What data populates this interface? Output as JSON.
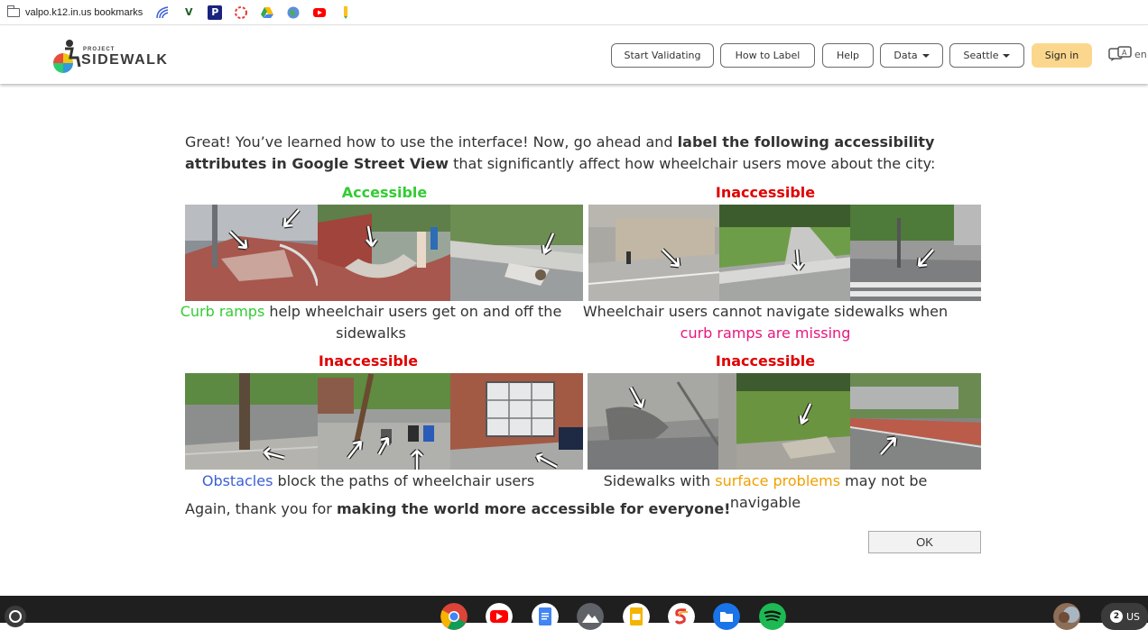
{
  "bookmarks": {
    "folder_label": "valpo.k12.in.us bookmarks",
    "icons": [
      "signal-icon",
      "vimeo-v-icon",
      "p-icon",
      "target-icon",
      "drive-icon",
      "globe-icon",
      "youtube-icon",
      "pencil-icon"
    ]
  },
  "header": {
    "logo_project": "PROJECT",
    "logo_sidewalk": "SIDEWALK",
    "nav": {
      "start_validating": "Start Validating",
      "how_to_label": "How to Label",
      "help": "Help",
      "data": "Data",
      "city": "Seattle",
      "sign_in": "Sign in",
      "language": "en"
    }
  },
  "intro": {
    "part1": "Great! You’ve learned how to use the interface! Now, go ahead and ",
    "bold": "label the following accessibility attributes in Google Street View",
    "part2": " that significantly affect how wheelchair users move about the city:"
  },
  "sections": [
    {
      "title": "Accessible",
      "title_color": "#33cc33",
      "caption_highlight": "Curb ramps",
      "highlight_color": "#33cc33",
      "caption_rest": " help wheelchair users get on and off the sidewalks"
    },
    {
      "title": "Inaccessible",
      "title_color": "#e00000",
      "caption_pre": "Wheelchair users cannot navigate sidewalks when ",
      "caption_highlight": "curb ramps are missing",
      "highlight_color": "#e8177d"
    },
    {
      "title": "Inaccessible",
      "title_color": "#e00000",
      "caption_highlight": "Obstacles",
      "highlight_color": "#3b5fd6",
      "caption_rest": " block the paths of wheelchair users"
    },
    {
      "title": "Inaccessible",
      "title_color": "#e00000",
      "caption_pre": "Sidewalks with ",
      "caption_highlight": "surface problems",
      "highlight_color": "#f0a000",
      "caption_rest": " may not be navigable"
    }
  ],
  "closing": {
    "pre": "Again, thank you for ",
    "bold": "making the world more accessible for everyone!"
  },
  "ok_button": "OK",
  "taskbar": {
    "apps": [
      "chrome-icon",
      "youtube-icon",
      "docs-icon",
      "photos-icon",
      "slides-icon",
      "sketch-icon",
      "files-icon",
      "spotify-icon"
    ],
    "tray_count": "2",
    "tray_locale": "US"
  }
}
